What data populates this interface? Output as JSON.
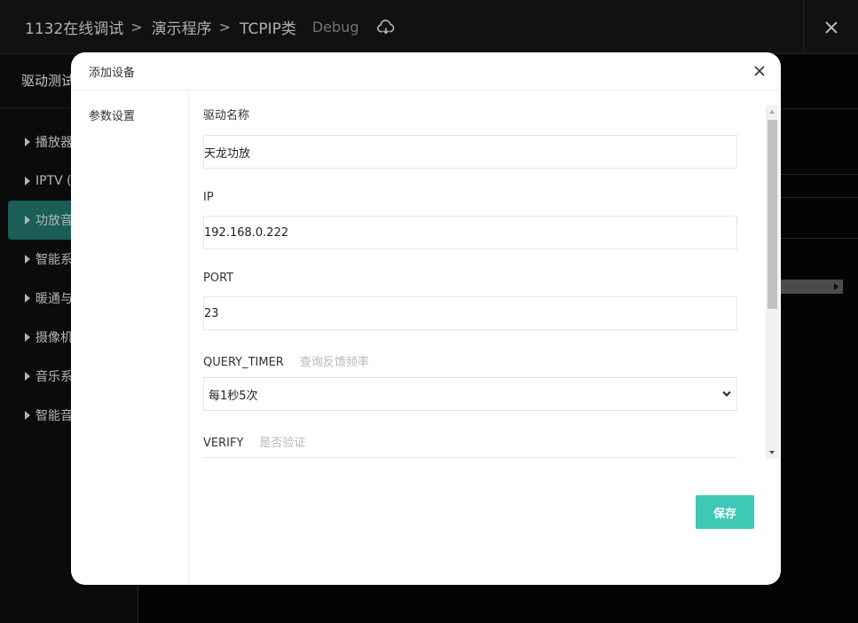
{
  "header": {
    "breadcrumb": [
      "1132在线调试",
      "演示程序",
      "TCPIP类"
    ],
    "mode": "Debug"
  },
  "left_panel": {
    "title": "驱动测试",
    "items": [
      {
        "label": "播放器"
      },
      {
        "label": "IPTV ("
      },
      {
        "label": "功放音"
      },
      {
        "label": "智能系"
      },
      {
        "label": "暖通与"
      },
      {
        "label": "摄像机"
      },
      {
        "label": "音乐系"
      },
      {
        "label": "智能音"
      }
    ]
  },
  "modal": {
    "title": "添加设备",
    "side_items": [
      "参数设置"
    ],
    "fields": [
      {
        "label": "驱动名称",
        "value": "天龙功放"
      },
      {
        "label": "IP",
        "value": "192.168.0.222"
      },
      {
        "label": "PORT",
        "value": "23"
      },
      {
        "label": "QUERY_TIMER",
        "hint": "查询反馈频率",
        "value": "每1秒5次"
      },
      {
        "label": "VERIFY",
        "hint": "是否验证"
      }
    ],
    "save_label": "保存"
  },
  "colors": {
    "accent": "#3ec9b6",
    "active_item": "#1f6f66"
  },
  "icons": [
    "chevron-right-icon",
    "cloud-icon",
    "close-icon",
    "chevron-down-icon",
    "triangle-right-icon"
  ]
}
